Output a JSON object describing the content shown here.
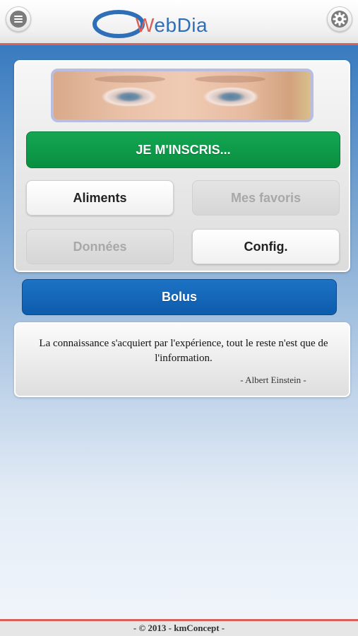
{
  "header": {
    "logo_text_w": "W",
    "logo_text_rest": "ebDia",
    "menu_icon": "menu-icon",
    "settings_icon": "gear-icon"
  },
  "colors": {
    "accent_red": "#d8615a",
    "brand_blue": "#2f6fb8",
    "green_button": "#0a9a48",
    "blue_button": "#1566b8"
  },
  "panel": {
    "register_label": "JE M'INSCRIS...",
    "buttons": [
      {
        "label": "Aliments",
        "enabled": true
      },
      {
        "label": "Mes favoris",
        "enabled": false
      },
      {
        "label": "Données",
        "enabled": false
      },
      {
        "label": "Config.",
        "enabled": true
      }
    ]
  },
  "bolus_label": "Bolus",
  "quote": {
    "text": "La connaissance s'acquiert par l'expérience, tout le reste n'est que de l'information.",
    "author": "- Albert Einstein -"
  },
  "footer": {
    "text": "- © 2013 - kmConcept -"
  }
}
